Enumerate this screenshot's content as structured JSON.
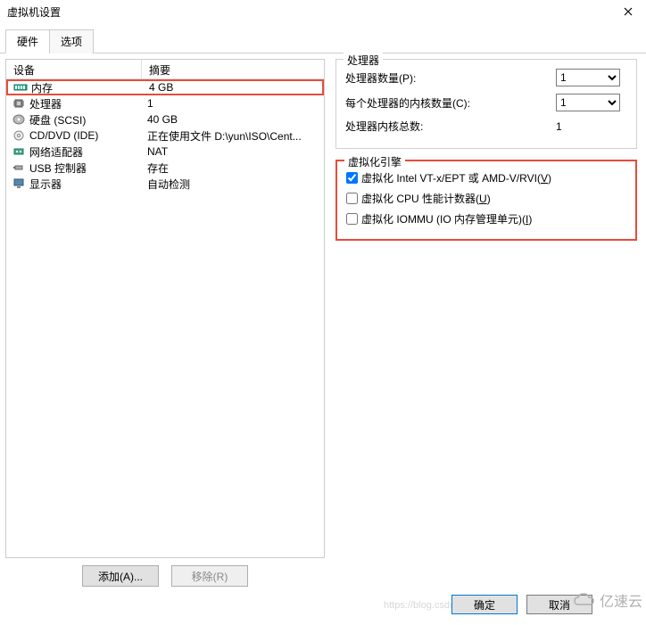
{
  "window": {
    "title": "虚拟机设置"
  },
  "tabs": {
    "hardware": "硬件",
    "options": "选项"
  },
  "list_header": {
    "device": "设备",
    "summary": "摘要"
  },
  "devices": [
    {
      "name": "内存",
      "summary": "4 GB",
      "icon": "memory"
    },
    {
      "name": "处理器",
      "summary": "1",
      "icon": "cpu"
    },
    {
      "name": "硬盘 (SCSI)",
      "summary": "40 GB",
      "icon": "disk"
    },
    {
      "name": "CD/DVD (IDE)",
      "summary": "正在使用文件 D:\\yun\\ISO\\Cent...",
      "icon": "cd"
    },
    {
      "name": "网络适配器",
      "summary": "NAT",
      "icon": "network"
    },
    {
      "name": "USB 控制器",
      "summary": "存在",
      "icon": "usb"
    },
    {
      "name": "显示器",
      "summary": "自动检测",
      "icon": "display"
    }
  ],
  "buttons": {
    "add": "添加(A)...",
    "remove": "移除(R)"
  },
  "processor_group": {
    "title": "处理器",
    "count_label": "处理器数量(P):",
    "count_value": "1",
    "cores_label": "每个处理器的内核数量(C):",
    "cores_value": "1",
    "total_label": "处理器内核总数:",
    "total_value": "1"
  },
  "virt_group": {
    "title": "虚拟化引擎",
    "vt_label_1": "虚拟化 Intel VT-x/EPT 或 AMD-V/RVI(",
    "vt_label_u": "V",
    "vt_label_2": ")",
    "perf_label_1": "虚拟化 CPU 性能计数器(",
    "perf_label_u": "U",
    "perf_label_2": ")",
    "iommu_label_1": "虚拟化 IOMMU (IO 内存管理单元)(",
    "iommu_label_u": "I",
    "iommu_label_2": ")"
  },
  "bottom": {
    "ok": "确定",
    "cancel": "取消"
  },
  "watermark": "亿速云"
}
